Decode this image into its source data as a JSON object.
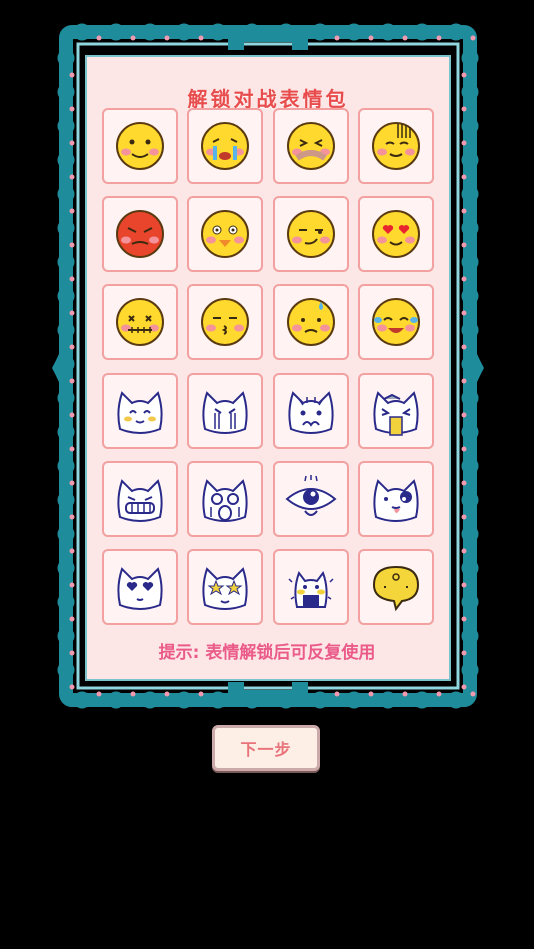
{
  "title": "解锁对战表情包",
  "hint": "提示: 表情解锁后可反复使用",
  "next_button": "下一步",
  "colors": {
    "frame": "#2aa3b3",
    "panel": "#fde6e6",
    "cell_border": "#f2a0a0",
    "title": "#e84c4c",
    "hint": "#ea5b8a"
  },
  "emojis": [
    {
      "name": "smile-emoji-icon"
    },
    {
      "name": "crying-emoji-icon"
    },
    {
      "name": "cover-mouth-emoji-icon"
    },
    {
      "name": "speechless-emoji-icon"
    },
    {
      "name": "angry-emoji-icon"
    },
    {
      "name": "happy-wink-emoji-icon"
    },
    {
      "name": "smirk-emoji-icon"
    },
    {
      "name": "heart-eyes-emoji-icon"
    },
    {
      "name": "sealed-mouth-emoji-icon"
    },
    {
      "name": "pouting-emoji-icon"
    },
    {
      "name": "sweat-emoji-icon"
    },
    {
      "name": "laugh-tears-emoji-icon"
    },
    {
      "name": "cat-smile-icon"
    },
    {
      "name": "cat-crying-icon"
    },
    {
      "name": "cat-shocked-icon"
    },
    {
      "name": "cat-vomit-icon"
    },
    {
      "name": "cat-grin-icon"
    },
    {
      "name": "cat-scream-icon"
    },
    {
      "name": "big-eye-icon"
    },
    {
      "name": "cat-tongue-icon"
    },
    {
      "name": "cat-heart-eyes-icon"
    },
    {
      "name": "cat-star-eyes-icon"
    },
    {
      "name": "cat-blush-icon"
    },
    {
      "name": "speech-bubble-icon"
    }
  ]
}
